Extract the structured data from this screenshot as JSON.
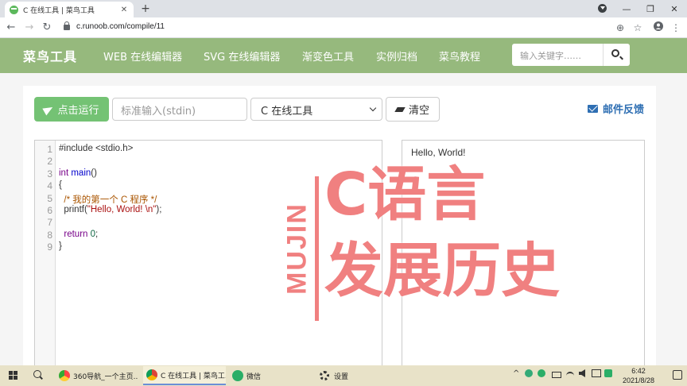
{
  "browser": {
    "tab_title": "C 在线工具 | 菜鸟工具",
    "tab_close": "✕",
    "new_tab": "+",
    "url": "c.runoob.com/compile/11",
    "back": "←",
    "forward": "→",
    "reload": "↻",
    "zoom": "⊕",
    "star": "☆",
    "menu": "⋮",
    "minimize": "—",
    "restore": "❐",
    "close": "✕"
  },
  "site": {
    "logo": "菜鸟工具",
    "nav": [
      "WEB 在线编辑器",
      "SVG 在线编辑器",
      "渐变色工具",
      "实例归档",
      "菜鸟教程"
    ],
    "search_placeholder": "输入关键字……"
  },
  "toolbar": {
    "run_label": "点击运行",
    "stdin_placeholder": "标准输入(stdin)",
    "language": "C 在线工具",
    "clear_label": "清空",
    "feedback_label": "邮件反馈"
  },
  "editor": {
    "line_numbers": [
      "1",
      "2",
      "3",
      "4",
      "5",
      "6",
      "7",
      "8",
      "9"
    ],
    "line1": "#include <stdio.h>",
    "line3_kw": "int",
    "line3_fn": " main",
    "line3_rest": "()",
    "line4": "{",
    "line5": "  /* 我的第一个 C 程序 */",
    "line6_a": "  printf(",
    "line6_str": "\"Hello, World! \\n\"",
    "line6_b": ");",
    "line8_kw": "  return",
    "line8_num": " 0",
    "line8_rest": ";",
    "line9": "}"
  },
  "output": {
    "text": "Hello, World!"
  },
  "overlay": {
    "vertical_text": "MUJIN",
    "line1": "C语言",
    "line2": "发展历史",
    "color": "#f08080"
  },
  "taskbar": {
    "tasks": [
      "360导航_一个主页...",
      "C 在线工具 | 菜鸟工...",
      "微信",
      "设置"
    ],
    "tray_up": "^",
    "time": "6:42",
    "date": "2021/8/28"
  }
}
